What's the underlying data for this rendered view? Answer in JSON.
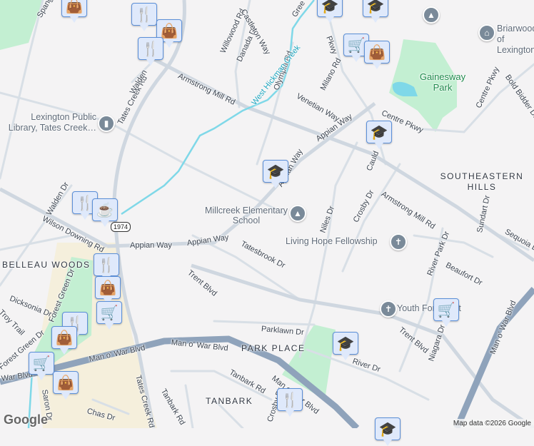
{
  "roads": {
    "armstrong_mill_rd": "Armstrong Mill Rd",
    "armstrong_mill_rd_2": "Armstrong Mill Rd",
    "tates_creek_rd": "Tates Creek Rd",
    "tates_creek_rd_2": "Tates Creek Rd",
    "man_o_war_1": "Man o' War Blvd",
    "man_o_war_2": "Man o' War Blvd",
    "man_o_war_3": "Man o' War Blvd",
    "man_o_war_4": "Man o' War Blvd",
    "man_o_war_5": "War Blvd",
    "appian_way_1": "Appian Way",
    "appian_way_2": "Appian Way",
    "appian_way_3": "Appian Way",
    "appian_way_4": "Appian Way",
    "wilson_downing": "Wilson Downing Rd",
    "walden_dr": "Walden Dr",
    "walden": "Walden",
    "trent_blvd_1": "Trent Blvd",
    "trent_blvd_2": "Trent Blvd",
    "tatesbrook": "Tatesbrook Dr",
    "parklawn": "Parklawn Dr",
    "river_dr": "River Dr",
    "niagara": "Niagara Dr",
    "river_park": "River Park Dr",
    "beaufort": "Beaufort Dr",
    "sequoia": "Sequoia Dr",
    "sundart": "Sundart Dr",
    "crosby_1": "Crosby Dr",
    "crosby_2": "Crosby Dr",
    "niles": "Niles Dr",
    "cauld": "Cauld",
    "centre_pkwy_1": "Centre Pkwy",
    "centre_pkwy_2": "Centre Pkwy",
    "bold_bidder": "Bold Bidder Dr",
    "venetian": "Venetian Way",
    "milano": "Milano Rd",
    "olympia": "Olympia Rd",
    "pkwy": "Pkwy",
    "willowood": "Willowood Rd",
    "danada": "Danada Dr",
    "castleton": "Castleton Way",
    "greer": "Gree",
    "spang": "Spang",
    "dicksonia": "Dicksonia Dr",
    "forest_green": "Forest Green Dr",
    "forest_green_2": "Forest Green Dr",
    "troy_trail": "Troy Trail",
    "saron": "Saron Dr",
    "chas": "Chas Dr",
    "tanbark_rd_1": "Tanbark Rd",
    "tanbark_rd_2": "Tanbark Rd",
    "route_1974": "1974"
  },
  "waterways": {
    "west_hickman_creek": "West Hickman Creek"
  },
  "neighborhoods": {
    "southeastern_hills": "SOUTHEASTERN HILLS",
    "belleau_woods": "BELLEAU WOODS",
    "park_place": "PARK PLACE",
    "tanbark": "TANBARK"
  },
  "parks": {
    "gainesway": "Gainesway Park"
  },
  "pois": {
    "library": "Lexington Public Library, Tates Creek…",
    "millcreek": "Millcreek Elementary School",
    "living_hope": "Living Hope Fellowship",
    "youth": "Youth For Christ",
    "briarwood": "Briarwood of Lexington"
  },
  "attribution": {
    "logo": "Google",
    "map_data": "Map data ©2026 Google"
  },
  "colors": {
    "background": "#f4f3f4",
    "road": "#d3dae2",
    "highway": "#8fa3bb",
    "park": "#c3efd2",
    "water": "#7fd8e8",
    "marker": "#0b4468",
    "shopping_area": "#f5efdc"
  }
}
